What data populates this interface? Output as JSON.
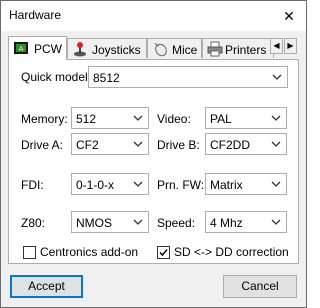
{
  "window": {
    "title": "Hardware",
    "close_glyph": "✕"
  },
  "tabs": [
    {
      "label": "PCW",
      "icon": "pcw-chip-icon",
      "active": true
    },
    {
      "label": "Joysticks",
      "icon": "joystick-icon",
      "active": false
    },
    {
      "label": "Mice",
      "icon": "mouse-icon",
      "active": false
    },
    {
      "label": "Printers",
      "icon": "printer-icon",
      "active": false
    }
  ],
  "tab_scroll": {
    "left": "◀",
    "right": "▶"
  },
  "fields": {
    "quick_model": {
      "label": "Quick model:",
      "value": "8512"
    },
    "memory": {
      "label": "Memory:",
      "value": "512"
    },
    "video": {
      "label": "Video:",
      "value": "PAL"
    },
    "drive_a": {
      "label": "Drive A:",
      "value": "CF2"
    },
    "drive_b": {
      "label": "Drive B:",
      "value": "CF2DD"
    },
    "fdi": {
      "label": "FDI:",
      "value": "0-1-0-x"
    },
    "prn_fw": {
      "label": "Prn. FW:",
      "value": "Matrix"
    },
    "z80": {
      "label": "Z80:",
      "value": "NMOS"
    },
    "speed": {
      "label": "Speed:",
      "value": "4 Mhz"
    }
  },
  "checkboxes": {
    "centronics": {
      "label": "Centronics add-on",
      "checked": false
    },
    "sd_dd": {
      "label": "SD <-> DD correction",
      "checked": true
    }
  },
  "buttons": {
    "accept": "Accept",
    "cancel": "Cancel"
  },
  "colors": {
    "focus_border": "#0078d7",
    "panel_bg": "#ffffff",
    "window_bg": "#f0f0f0"
  }
}
